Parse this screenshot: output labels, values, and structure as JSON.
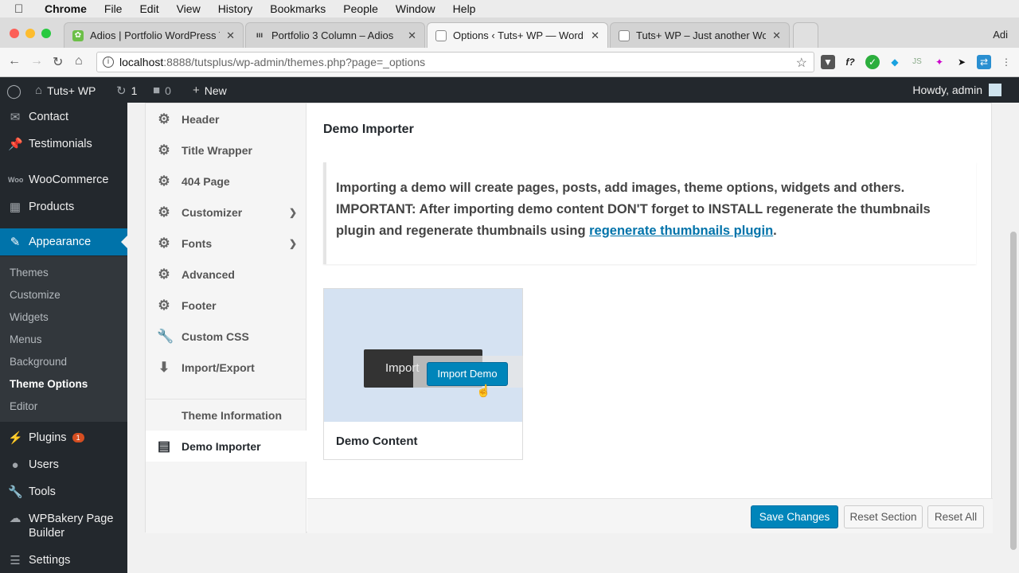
{
  "mac_menu": {
    "app": "Chrome",
    "items": [
      "File",
      "Edit",
      "View",
      "History",
      "Bookmarks",
      "People",
      "Window",
      "Help"
    ]
  },
  "browser": {
    "tabs": [
      {
        "title": "Adios | Portfolio WordPress Th"
      },
      {
        "title": "Portfolio 3 Column – Adios"
      },
      {
        "title": "Options ‹ Tuts+ WP — WordPr"
      },
      {
        "title": "Tuts+ WP – Just another Word"
      }
    ],
    "profile": "Adi",
    "url_host": "localhost",
    "url_rest": ":8888/tutsplus/wp-admin/themes.php?page=_options"
  },
  "admin_bar": {
    "site_name": "Tuts+ WP",
    "updates_count": "1",
    "comments_count": "0",
    "new_label": "New",
    "howdy": "Howdy, admin"
  },
  "sidebar": {
    "items": [
      {
        "label": "Contact"
      },
      {
        "label": "Testimonials"
      },
      {
        "label": "WooCommerce"
      },
      {
        "label": "Products"
      },
      {
        "label": "Appearance"
      },
      {
        "label": "Plugins",
        "badge": "1"
      },
      {
        "label": "Users"
      },
      {
        "label": "Tools"
      },
      {
        "label": "WPBakery Page Builder"
      },
      {
        "label": "Settings"
      }
    ],
    "submenu": [
      "Themes",
      "Customize",
      "Widgets",
      "Menus",
      "Background",
      "Theme Options",
      "Editor"
    ]
  },
  "options_nav": {
    "items": [
      "Header",
      "Title Wrapper",
      "404 Page",
      "Customizer",
      "Fonts",
      "Advanced",
      "Footer",
      "Custom CSS",
      "Import/Export"
    ],
    "theme_information": "Theme Information",
    "demo_importer": "Demo Importer"
  },
  "main": {
    "section_title": "Demo Importer",
    "description": "Importing a demo will create pages, posts, add images, theme options, widgets and others. IMPORTANT: After importing demo content DON'T forget to INSTALL regenerate the thumbnails plugin and regenerate thumbnails using ",
    "link_text": "regenerate thumbnails plugin",
    "link_suffix": ".",
    "demo": {
      "ghost_label": "Import",
      "button_label": "Import Demo",
      "name": "Demo Content"
    },
    "footer": {
      "save": "Save Changes",
      "reset_section": "Reset Section",
      "reset_all": "Reset All"
    }
  },
  "colors": {
    "wp_blue": "#0073aa",
    "admin_dark": "#23282d",
    "badge_red": "#d54e21"
  }
}
